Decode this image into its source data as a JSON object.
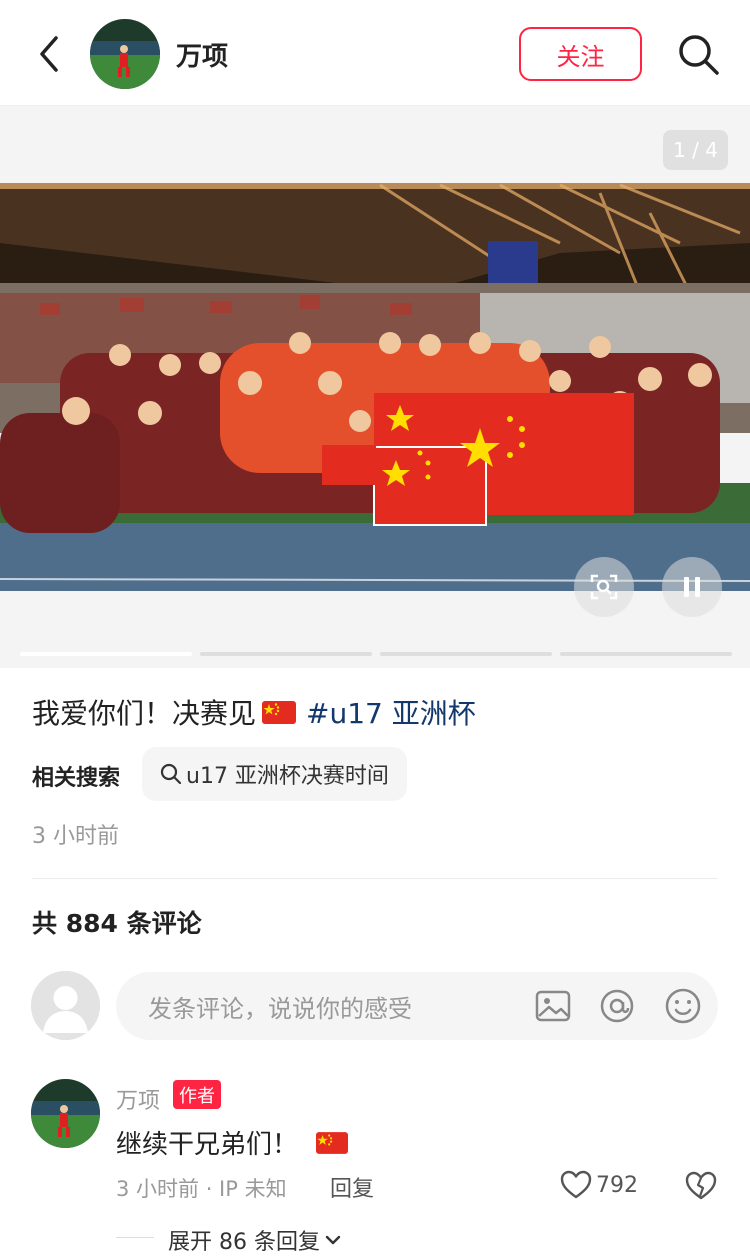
{
  "header": {
    "author_name": "万项",
    "follow_label": "关注"
  },
  "media": {
    "page_indicator": "1 / 4",
    "image_count": 4,
    "current_index": 1
  },
  "post": {
    "caption_text": "我爱你们！决赛见",
    "caption_emoji": "china-flag",
    "hashtag": "#u17 亚洲杯",
    "related_label": "相关搜索",
    "related_query": "u17 亚洲杯决赛时间",
    "timestamp": "3 小时前"
  },
  "comments": {
    "count_text": "共 884 条评论",
    "input_placeholder": "发条评论，说说你的感受",
    "items": [
      {
        "name": "万项",
        "badge": "作者",
        "text": "继续干兄弟们！",
        "meta": "3 小时前 · IP 未知",
        "reply_label": "回复",
        "likes": "792",
        "expand_label": "展开 86 条回复"
      }
    ]
  },
  "colors": {
    "accent": "#ff2442",
    "hashtag": "#13386c",
    "muted": "#999999"
  }
}
